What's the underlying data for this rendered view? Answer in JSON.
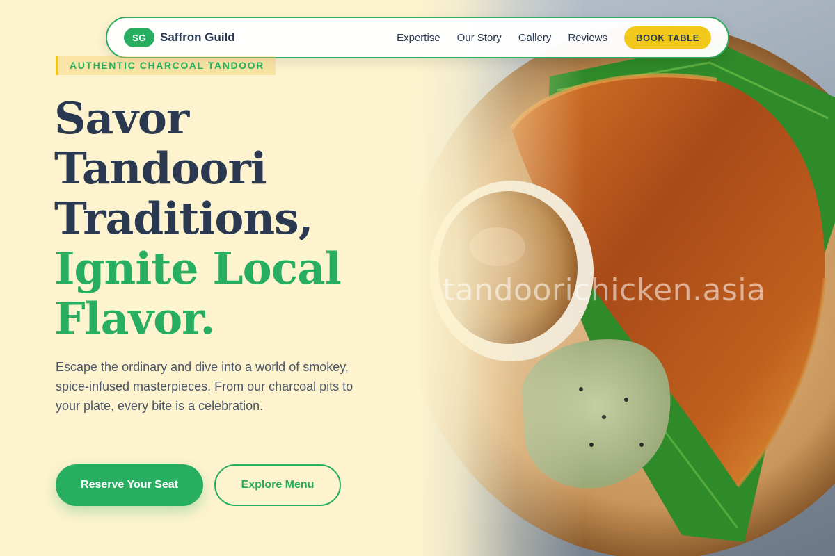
{
  "brand": {
    "badge": "SG",
    "name": "Saffron Guild"
  },
  "nav": {
    "links": [
      "Expertise",
      "Our Story",
      "Gallery",
      "Reviews"
    ],
    "cta": "BOOK TABLE"
  },
  "hero": {
    "eyebrow": "AUTHENTIC CHARCOAL TANDOOR",
    "headline_dark": [
      "Savor",
      "Tandoori",
      "Traditions,"
    ],
    "headline_green": [
      "Ignite Local",
      "Flavor."
    ],
    "description": "Escape the ordinary and dive into a world of smokey, spice-infused masterpieces. From our charcoal pits to your plate, every bite is a celebration.",
    "primary_cta": "Reserve Your Seat",
    "secondary_cta": "Explore Menu"
  },
  "image": {
    "subject": "dosa-with-sambar-and-chutney-photo",
    "watermark": "tandoorichicken.asia"
  },
  "colors": {
    "background": "#fdf3cf",
    "green": "#27ae60",
    "navy": "#2a3850",
    "yellow": "#f2c81a"
  }
}
